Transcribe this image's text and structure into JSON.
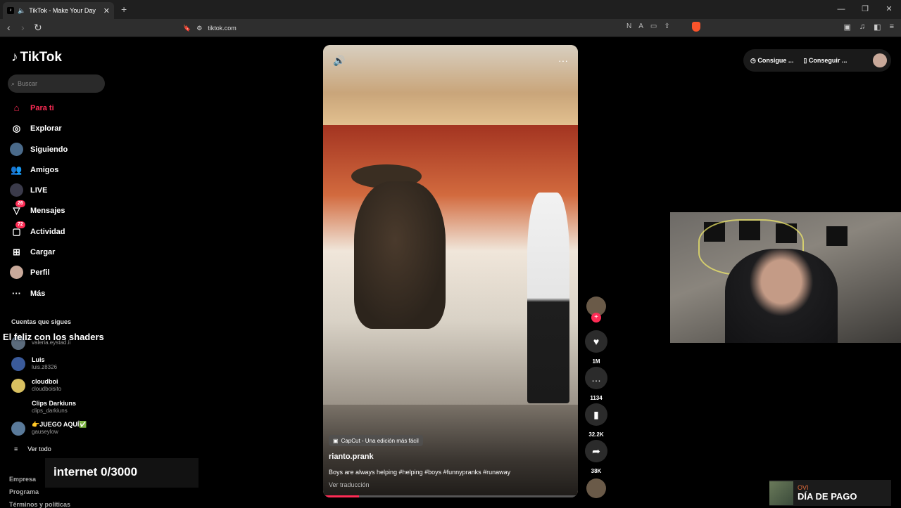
{
  "browser": {
    "tab_title": "TikTok - Make Your Day",
    "url": "tiktok.com",
    "new_tab": "+"
  },
  "logo": "TikTok",
  "search": {
    "placeholder": "Buscar"
  },
  "nav": [
    {
      "label": "Para ti",
      "icon": "home-icon",
      "active": true
    },
    {
      "label": "Explorar",
      "icon": "compass-icon"
    },
    {
      "label": "Siguiendo",
      "icon": "following-avatar-icon"
    },
    {
      "label": "Amigos",
      "icon": "friends-icon"
    },
    {
      "label": "LIVE",
      "icon": "live-icon"
    },
    {
      "label": "Mensajes",
      "icon": "messages-icon",
      "badge": "26"
    },
    {
      "label": "Actividad",
      "icon": "activity-icon",
      "badge": "72"
    },
    {
      "label": "Cargar",
      "icon": "upload-icon"
    },
    {
      "label": "Perfil",
      "icon": "profile-icon"
    },
    {
      "label": "Más",
      "icon": "more-icon"
    }
  ],
  "following": {
    "title": "Cuentas que sigues",
    "overlay": "El feliz con los shaders",
    "items": [
      {
        "name": "",
        "user": "valeria.eystad.ii"
      },
      {
        "name": "Luis",
        "user": "luis.z8326"
      },
      {
        "name": "cloudboi",
        "user": "cloudboisito"
      },
      {
        "name": "Clips Darkiuns",
        "user": "clips_darkiuns"
      },
      {
        "name": "👉JUEGO AQUÍ✅",
        "user": "gauseylow"
      }
    ],
    "see_all": "Ver todo"
  },
  "stream_overlay": {
    "internet": "internet  0/3000"
  },
  "footer": {
    "links": [
      "Empresa",
      "Programa",
      "Términos y políticas"
    ]
  },
  "video": {
    "capcut": "CapCut - Una edición más fácil",
    "author": "rianto.prank",
    "description": "Boys are always helping #helping #boys #funnypranks #runaway",
    "translate": "Ver traducción",
    "progress": 0.14
  },
  "actions": {
    "likes": "1M",
    "comments": "1134",
    "saves": "32.2K",
    "shares": "38K"
  },
  "topright": {
    "coins": "Consigue ...",
    "app": "Conseguir ..."
  },
  "widget": {
    "channel": "OVI",
    "title": "DÍA DE PAGO"
  },
  "colors": {
    "accent": "#fe2c55",
    "background": "#000000"
  }
}
